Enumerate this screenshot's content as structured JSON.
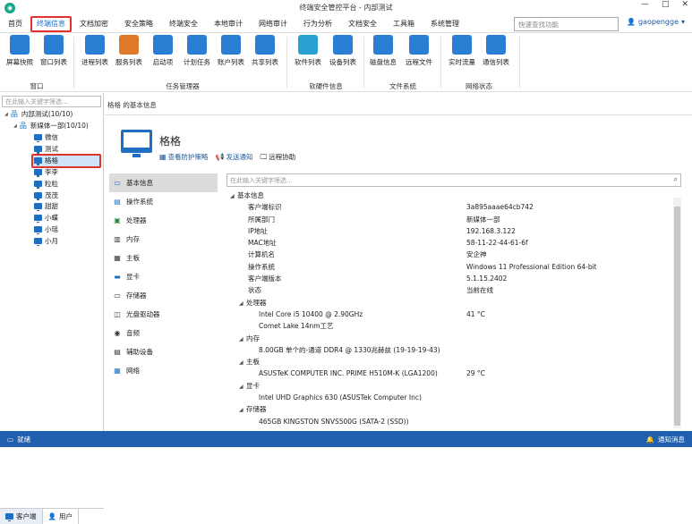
{
  "window": {
    "title": "终端安全管控平台 - 内部测试"
  },
  "menu": {
    "items": [
      "首页",
      "终端信息",
      "文档加密",
      "安全策略",
      "终端安全",
      "本地审计",
      "网络审计",
      "行为分析",
      "文档安全",
      "工具箱",
      "系统管理"
    ],
    "active_index": 1
  },
  "top": {
    "search_placeholder": "快速查找功能",
    "user": "gaopengge"
  },
  "ribbon": {
    "buttons": [
      {
        "label": "屏幕快照",
        "icon": "camera-icon"
      },
      {
        "label": "窗口列表",
        "icon": "window-list-icon"
      },
      {
        "label": "进程列表",
        "icon": "process-list-icon"
      },
      {
        "label": "服务列表",
        "icon": "service-list-icon"
      },
      {
        "label": "启动项",
        "icon": "startup-icon"
      },
      {
        "label": "计划任务",
        "icon": "scheduled-task-icon"
      },
      {
        "label": "账户列表",
        "icon": "account-list-icon"
      },
      {
        "label": "共享列表",
        "icon": "share-list-icon"
      },
      {
        "label": "软件列表",
        "icon": "software-list-icon"
      },
      {
        "label": "设备列表",
        "icon": "device-list-icon"
      },
      {
        "label": "磁盘信息",
        "icon": "disk-info-icon"
      },
      {
        "label": "远程文件",
        "icon": "remote-file-icon"
      },
      {
        "label": "实时流量",
        "icon": "traffic-icon"
      },
      {
        "label": "通信列表",
        "icon": "connection-list-icon"
      }
    ],
    "groups": [
      "窗口",
      "任务管理器",
      "软硬件信息",
      "文件系统",
      "网络状态"
    ]
  },
  "tree": {
    "search_placeholder": "在此输入关键字筛选...",
    "root": "内部测试(10/10)",
    "dept": "新媒体一部(10/10)",
    "hosts": [
      "微信",
      "测试",
      "格格",
      "李李",
      "粒粒",
      "茂茂",
      "甜甜",
      "小蝶",
      "小瑶",
      "小月"
    ],
    "selected": "格格"
  },
  "left_tabs": [
    "客户端",
    "用户"
  ],
  "main": {
    "breadcrumb": "格格 的基本信息",
    "host_name": "格格",
    "actions": [
      "查看防护策略",
      "发送通知",
      "远程协助"
    ],
    "nav": [
      "基本信息",
      "操作系统",
      "处理器",
      "内存",
      "主板",
      "显卡",
      "存储器",
      "光盘驱动器",
      "音频",
      "辅助设备",
      "网络"
    ],
    "nav_active": 0,
    "detail_search_placeholder": "在此输入关键字筛选...",
    "props": [
      {
        "level": 0,
        "group": true,
        "key": "基本信息",
        "val": ""
      },
      {
        "level": 1,
        "key": "客户端标识",
        "val": "3a895aaae64cb742"
      },
      {
        "level": 1,
        "key": "所属部门",
        "val": "新媒体一部"
      },
      {
        "level": 1,
        "key": "IP地址",
        "val": "192.168.3.122"
      },
      {
        "level": 1,
        "key": "MAC地址",
        "val": "58-11-22-44-61-6f"
      },
      {
        "level": 1,
        "key": "计算机名",
        "val": "安企神"
      },
      {
        "level": 1,
        "key": "操作系统",
        "val": "Windows 11 Professional Edition 64-bit"
      },
      {
        "level": 1,
        "key": "客户端版本",
        "val": "5.1.15.2402"
      },
      {
        "level": 1,
        "key": "状态",
        "val": "当前在线"
      },
      {
        "level": 1,
        "group": true,
        "key": "处理器",
        "val": ""
      },
      {
        "level": 2,
        "key": "Intel Core i5 10400 @ 2.90GHz",
        "val": "41 °C"
      },
      {
        "level": 2,
        "key": "Comet Lake 14nm工艺",
        "val": ""
      },
      {
        "level": 1,
        "group": true,
        "key": "内存",
        "val": ""
      },
      {
        "level": 2,
        "key": "8.00GB 单个的-通道 DDR4 @ 1330兆赫兹 (19-19-19-43)",
        "val": ""
      },
      {
        "level": 1,
        "group": true,
        "key": "主板",
        "val": ""
      },
      {
        "level": 2,
        "key": "ASUSTeK COMPUTER INC. PRIME H510M-K (LGA1200)",
        "val": "29 °C"
      },
      {
        "level": 1,
        "group": true,
        "key": "显卡",
        "val": ""
      },
      {
        "level": 2,
        "key": "Intel UHD Graphics 630 (ASUSTek Computer Inc)",
        "val": ""
      },
      {
        "level": 1,
        "group": true,
        "key": "存储器",
        "val": ""
      },
      {
        "level": 2,
        "key": "465GB KINGSTON SNVS500G (SATA-2 (SSD))",
        "val": ""
      }
    ]
  },
  "status": {
    "left": "就绪",
    "right": "通知消息"
  },
  "colors": {
    "accent": "#1f6fc0",
    "status_bar": "#1f5fae",
    "highlight": "#e03030"
  }
}
